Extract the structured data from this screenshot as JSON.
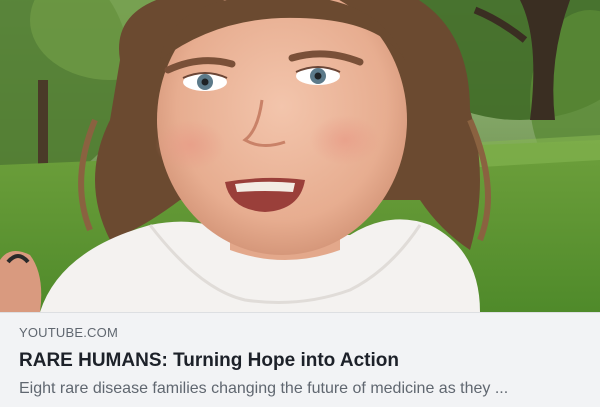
{
  "link_preview": {
    "thumbnail": {
      "subject": "child-portrait-photo"
    },
    "source": "YOUTUBE.COM",
    "title": "RARE HUMANS: Turning Hope into Action",
    "description": "Eight rare disease families changing the future of medicine as they ..."
  },
  "colors": {
    "meta_background": "#f2f3f5",
    "title_text": "#1d2129",
    "secondary_text": "#606770",
    "border": "#dddfe2"
  }
}
